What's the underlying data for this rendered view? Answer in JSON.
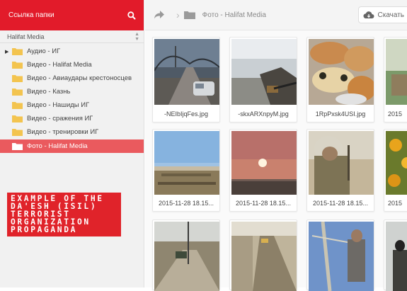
{
  "sidebar": {
    "header_title": "Ссылка папки",
    "select_value": "Halifat Media",
    "items": [
      {
        "label": "Аудио - ИГ",
        "expandable": true,
        "active": false
      },
      {
        "label": "Видео - Halifat Media",
        "expandable": false,
        "active": false
      },
      {
        "label": "Видео - Авиаудары крестоносцев",
        "expandable": false,
        "active": false
      },
      {
        "label": "Видео - Казнь",
        "expandable": false,
        "active": false
      },
      {
        "label": "Видео - Нашиды ИГ",
        "expandable": false,
        "active": false
      },
      {
        "label": "Видео - сражения ИГ",
        "expandable": false,
        "active": false
      },
      {
        "label": "Видео - тренировки ИГ",
        "expandable": false,
        "active": false
      },
      {
        "label": "Фото - Halifat Media",
        "expandable": false,
        "active": true
      }
    ]
  },
  "watermark": {
    "lines": [
      "EXAMPLE OF THE",
      "DA'ESH (ISIL)",
      "TERRORIST",
      "ORGANIZATION",
      "PROPAGANDA"
    ]
  },
  "toolbar": {
    "breadcrumb": "Фото - Halifat Media",
    "download_label": "Скачать"
  },
  "files": [
    {
      "name": "-NEIbIjqFes.jpg"
    },
    {
      "name": "-skxARXnpyM.jpg"
    },
    {
      "name": "1RpPxsk4USI.jpg"
    },
    {
      "name": "2015"
    },
    {
      "name": "2015-11-28 18.15..."
    },
    {
      "name": "2015-11-28 18.15..."
    },
    {
      "name": "2015-11-28 18.15..."
    },
    {
      "name": "2015"
    },
    {
      "name": ""
    },
    {
      "name": ""
    },
    {
      "name": ""
    },
    {
      "name": ""
    }
  ],
  "colors": {
    "accent": "#e21b2a",
    "active_item": "#ea5a5e",
    "folder": "#f3c44f"
  }
}
